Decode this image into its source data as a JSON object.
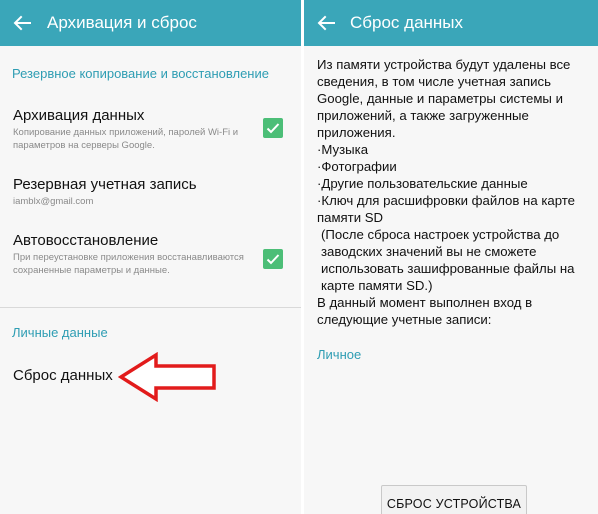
{
  "left": {
    "appbar": {
      "title": "Архивация и сброс",
      "back_icon": "arrow-left-icon"
    },
    "section_backup": {
      "title": "Резервное копирование и восстановление"
    },
    "items": [
      {
        "title": "Архивация данных",
        "summary": "Копирование данных приложений, паролей Wi-Fi и параметров на серверы Google.",
        "checked": true
      },
      {
        "title": "Резервная учетная запись",
        "summary": "iamblx@gmail.com"
      },
      {
        "title": "Автовосстановление",
        "summary": "При переустановке приложения восстанавливаются сохраненные параметры и данные.",
        "checked": true
      }
    ],
    "section_personal": {
      "title": "Личные данные"
    },
    "reset_item": {
      "title": "Сброс данных"
    },
    "annotation": {
      "icon": "left-arrow-annotation-icon",
      "color": "#e21b1b"
    }
  },
  "right": {
    "appbar": {
      "title": "Сброс данных",
      "back_icon": "arrow-left-icon"
    },
    "intro": "Из памяти устройства будут удалены все сведения, в том числе учетная запись Google, данные и параметры системы и приложений, а также загруженные приложения.",
    "bullets": [
      "Музыка",
      "Фотографии",
      "Другие пользовательские данные",
      "Ключ для расшифровки файлов на карте памяти SD"
    ],
    "note": "(После сброса настроек устройства до заводских значений вы не сможете использовать зашифрованные файлы на карте памяти SD.)",
    "accounts_text": "В данный момент выполнен вход в следующие учетные записи:",
    "account_section": "Личное",
    "reset_button": "СБРОС УСТРОЙСТВА"
  },
  "colors": {
    "appbar": "#3aa6b9",
    "accent": "#2e9db3",
    "checkbox": "#4cbe77"
  }
}
